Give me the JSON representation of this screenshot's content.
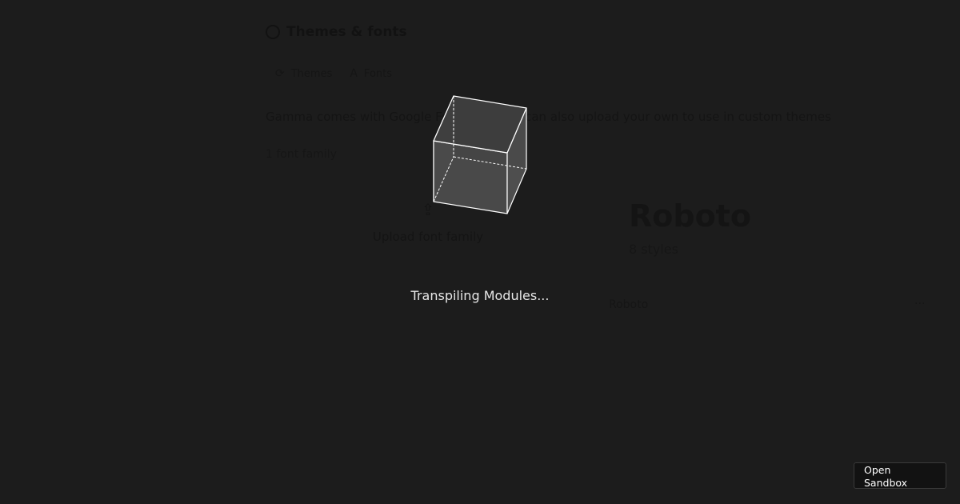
{
  "app": {
    "title": "Themes & fonts",
    "tabs": [
      {
        "label": "Themes",
        "icon": "brush-icon"
      },
      {
        "label": "Fonts",
        "icon": "font-icon"
      }
    ],
    "description": "Gamma comes with Google Fonts, but you can also upload your own to use in custom themes",
    "family_count": "1 font family",
    "upload_label": "Upload font family",
    "font_card": {
      "name": "Roboto",
      "styles": "8 styles",
      "row_label": "Roboto",
      "more": "···"
    }
  },
  "overlay": {
    "status": "Transpiling Modules...",
    "open_sandbox_label": "Open Sandbox",
    "cube_icon": "cube-loader-icon"
  },
  "colors": {
    "background": "#1c1c1c",
    "status_text": "#e6e6e6",
    "cube_fill": "#4a4a4a",
    "cube_stroke": "#ffffff"
  }
}
